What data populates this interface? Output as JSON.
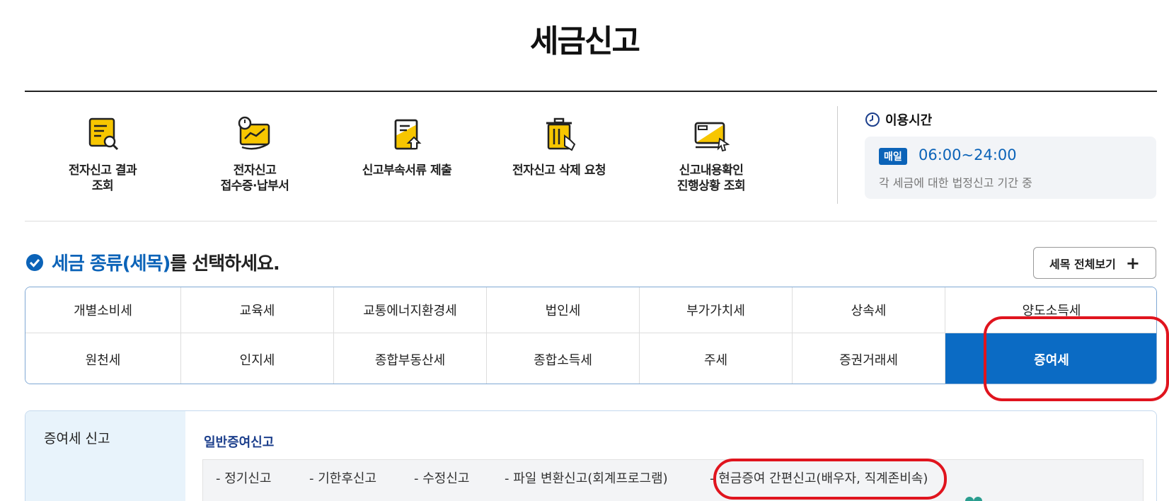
{
  "page": {
    "title": "세금신고"
  },
  "quick_menu": [
    {
      "label": "전자신고 결과\n조회",
      "icon": "scroll-search-icon"
    },
    {
      "label": "전자신고\n접수증·납부서",
      "icon": "clock-hand-chart-icon"
    },
    {
      "label": "신고부속서류 제출",
      "icon": "document-upload-icon"
    },
    {
      "label": "전자신고 삭제 요청",
      "icon": "trash-hand-icon"
    },
    {
      "label": "신고내용확인\n진행상황 조회",
      "icon": "monitor-cursor-icon"
    }
  ],
  "hours": {
    "title": "이용시간",
    "badge": "매일",
    "time": "06:00~24:00",
    "desc": "각 세금에 대한 법정신고 기간 중"
  },
  "selection": {
    "heading_blue": "세금 종류(세목)",
    "heading_rest": "를 선택하세요.",
    "view_all": "세목 전체보기"
  },
  "tax_types": {
    "row1": [
      "개별소비세",
      "교육세",
      "교통에너지환경세",
      "법인세",
      "부가가치세",
      "상속세",
      "양도소득세"
    ],
    "row2": [
      "원천세",
      "인지세",
      "종합부동산세",
      "종합소득세",
      "주세",
      "증권거래세",
      "증여세"
    ],
    "selected": "증여세"
  },
  "report": {
    "side_title": "증여세 신고",
    "sub_title": "일반증여신고",
    "links": [
      "- 정기신고",
      "- 기한후신고",
      "- 수정신고",
      "- 파일 변환신고(회계프로그램)",
      "- 현금증여 간편신고(배우자, 직계존비속)"
    ]
  },
  "colors": {
    "accent": "#0b63b8",
    "highlight": "#e0141e",
    "icon_yellow": "#f7c600"
  }
}
